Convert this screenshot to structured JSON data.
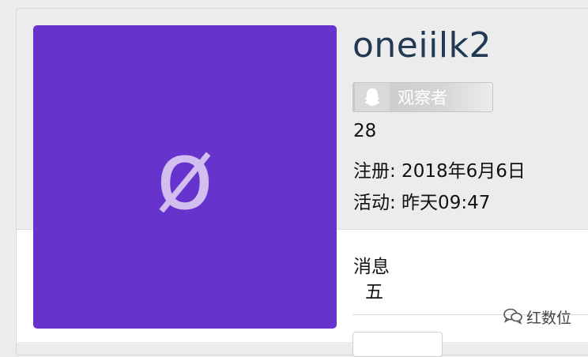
{
  "profile": {
    "avatar_letter": "ø",
    "avatar_color": "#6633cc",
    "username": "oneiilk2",
    "role": {
      "icon": "ghost-icon",
      "label": "观察者"
    },
    "count": "28",
    "registered": "注册: 2018年6月6日",
    "last_active": "活动: 昨天09:47"
  },
  "messages": {
    "label": "消息",
    "value": "五"
  },
  "watermark": {
    "icon": "chat-bubbles-icon",
    "text": "红数位"
  }
}
